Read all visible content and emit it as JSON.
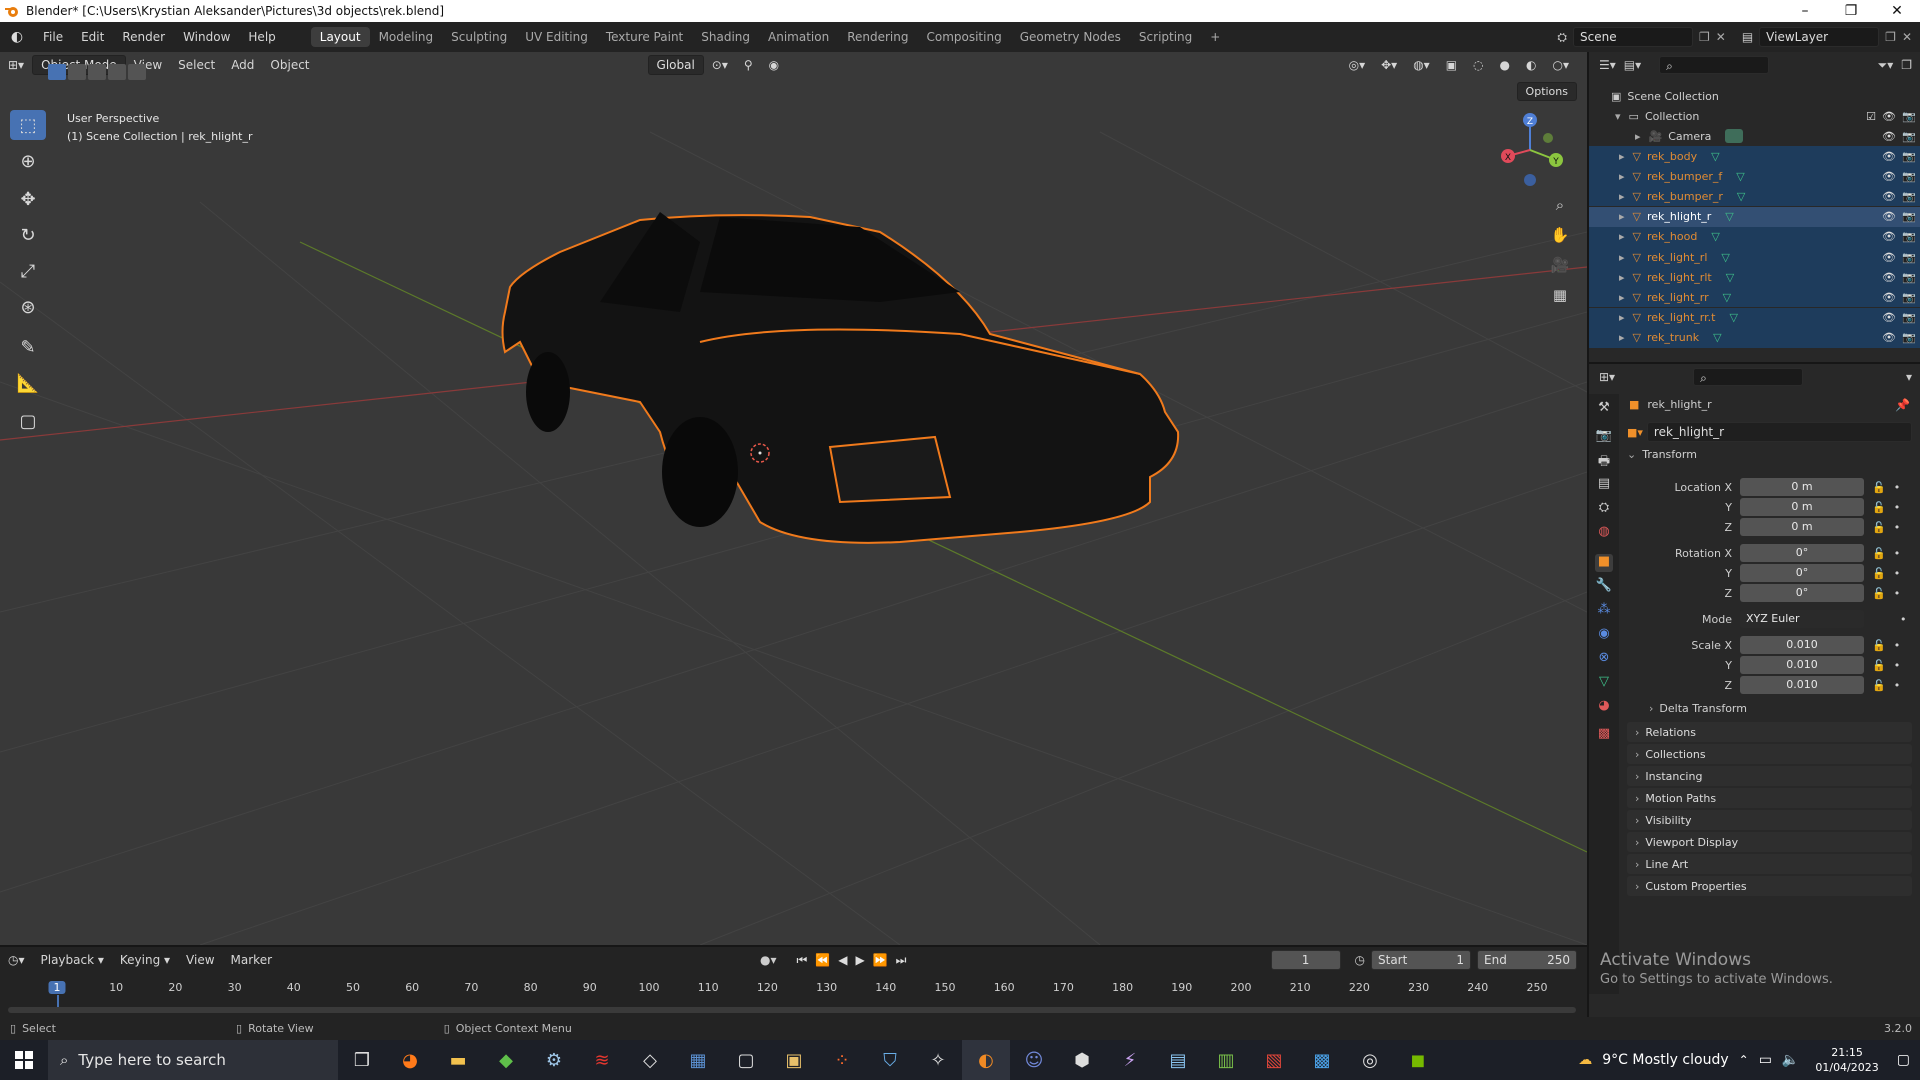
{
  "titlebar": {
    "title": "Blender* [C:\\Users\\Krystian Aleksander\\Pictures\\3d objects\\rek.blend]"
  },
  "menu": [
    "File",
    "Edit",
    "Render",
    "Window",
    "Help"
  ],
  "workspaces": [
    "Layout",
    "Modeling",
    "Sculpting",
    "UV Editing",
    "Texture Paint",
    "Shading",
    "Animation",
    "Rendering",
    "Compositing",
    "Geometry Nodes",
    "Scripting"
  ],
  "scene_name": "Scene",
  "view_layer": "ViewLayer",
  "viewport": {
    "mode": "Object Mode",
    "menus": [
      "View",
      "Select",
      "Add",
      "Object"
    ],
    "orientation": "Global",
    "options_label": "Options",
    "info_line1": "User Perspective",
    "info_line2": "(1) Scene Collection | rek_hlight_r",
    "gizmo_x": "X",
    "gizmo_y": "Y",
    "gizmo_z": "Z"
  },
  "outliner": {
    "scene_collection": "Scene Collection",
    "collection": "Collection",
    "camera": "Camera",
    "objects": [
      "rek_body",
      "rek_bumper_f",
      "rek_bumper_r",
      "rek_hlight_r",
      "rek_hood",
      "rek_light_rl",
      "rek_light_rlt",
      "rek_light_rr",
      "rek_light_rr.t",
      "rek_trunk"
    ],
    "active_object": "rek_hlight_r"
  },
  "properties": {
    "object_name": "rek_hlight_r",
    "data_name": "rek_hlight_r",
    "transform_label": "Transform",
    "location_label": "Location X",
    "rotation_label": "Rotation X",
    "scale_label": "Scale X",
    "y_label": "Y",
    "z_label": "Z",
    "location": [
      "0 m",
      "0 m",
      "0 m"
    ],
    "rotation": [
      "0°",
      "0°",
      "0°"
    ],
    "mode_label": "Mode",
    "mode_value": "XYZ Euler",
    "scale": [
      "0.010",
      "0.010",
      "0.010"
    ],
    "delta_transform": "Delta Transform",
    "sections": [
      "Relations",
      "Collections",
      "Instancing",
      "Motion Paths",
      "Visibility",
      "Viewport Display",
      "Line Art",
      "Custom Properties"
    ]
  },
  "timeline": {
    "menus": [
      "Playback",
      "Keying",
      "View",
      "Marker"
    ],
    "current_frame": "1",
    "start_label": "Start",
    "start_value": "1",
    "end_label": "End",
    "end_value": "250",
    "ticks": [
      "1",
      "10",
      "20",
      "30",
      "40",
      "50",
      "60",
      "70",
      "80",
      "90",
      "100",
      "110",
      "120",
      "130",
      "140",
      "150",
      "160",
      "170",
      "180",
      "190",
      "200",
      "210",
      "220",
      "230",
      "240",
      "250"
    ]
  },
  "statusbar": {
    "select": "Select",
    "rotate_view": "Rotate View",
    "context_menu": "Object Context Menu",
    "version": "3.2.0"
  },
  "activate_windows": {
    "title": "Activate Windows",
    "subtitle": "Go to Settings to activate Windows."
  },
  "taskbar": {
    "search_placeholder": "Type here to search",
    "weather": "9°C  Mostly cloudy",
    "time": "21:15",
    "date": "01/04/2023"
  },
  "colors": {
    "selection_outline": "#f07a1c",
    "selected_row": "#1e3c5c",
    "active_row": "#334f73",
    "viewport_bg": "#393939"
  }
}
